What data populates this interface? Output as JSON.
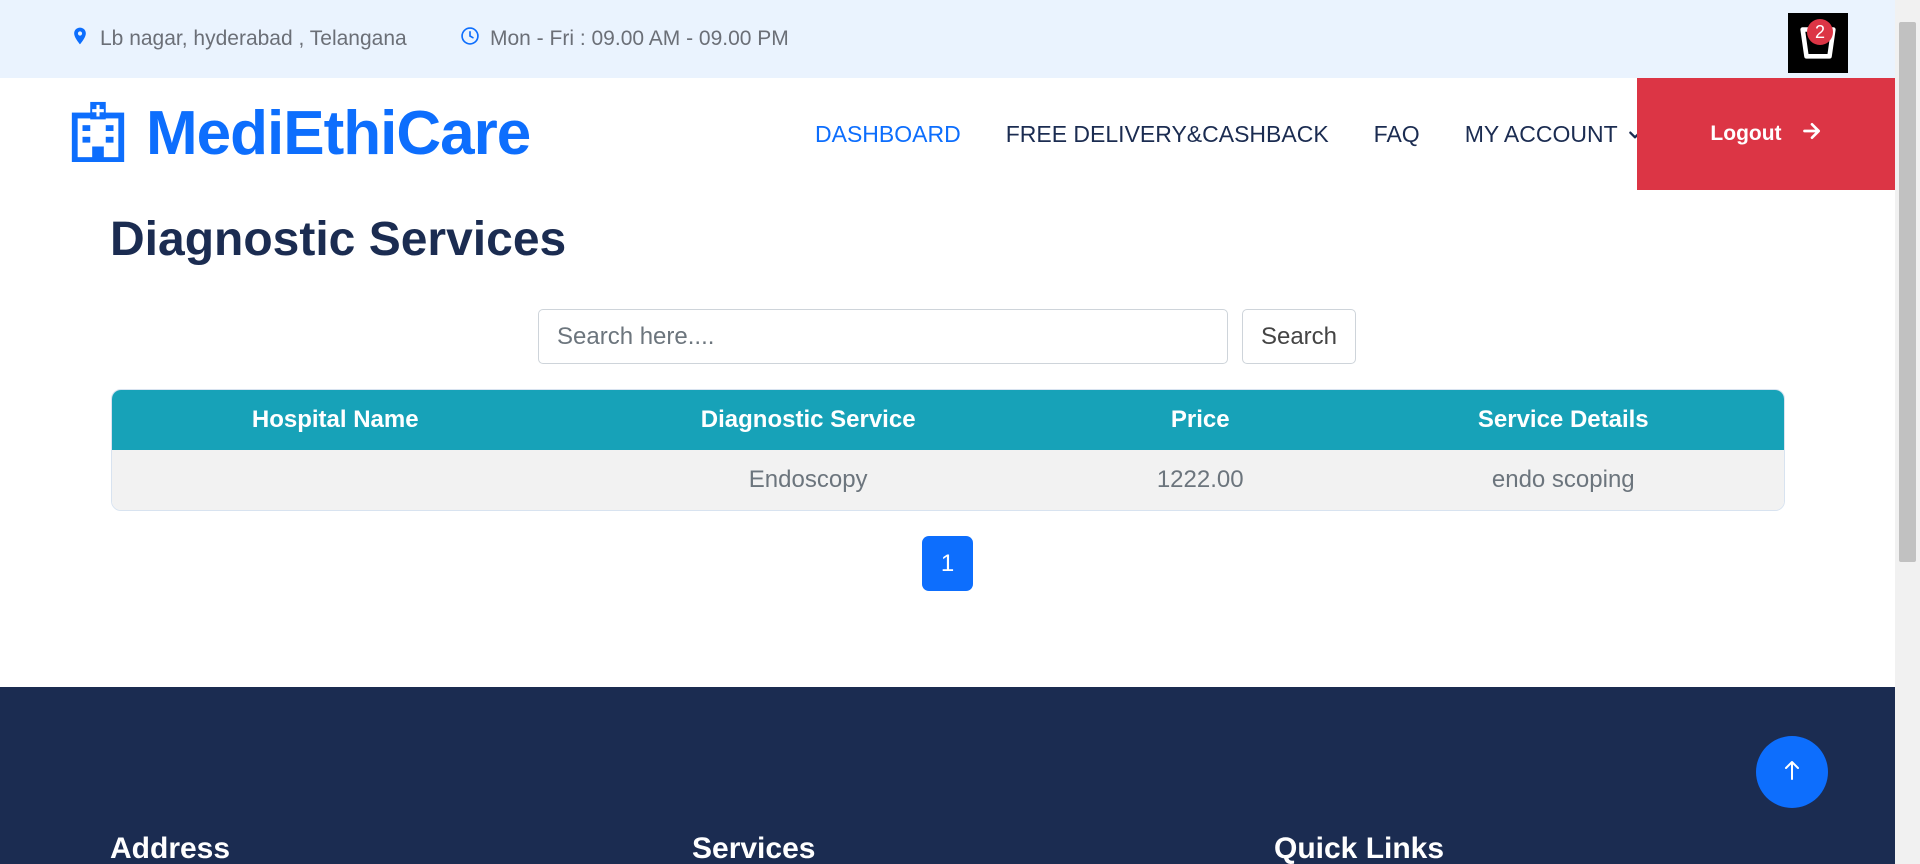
{
  "topbar": {
    "location": "Lb nagar, hyderabad , Telangana",
    "hours": "Mon - Fri : 09.00 AM - 09.00 PM",
    "cart_count": "2"
  },
  "brand": {
    "name": "MediEthiCare",
    "icon": "hospital-icon"
  },
  "nav": {
    "items": [
      "DASHBOARD",
      "FREE DELIVERY&CASHBACK",
      "FAQ",
      "MY ACCOUNT"
    ],
    "logout_label": "Logout"
  },
  "page": {
    "title": "Diagnostic Services",
    "search_placeholder": "Search here....",
    "search_button": "Search"
  },
  "table": {
    "headers": [
      "Hospital Name",
      "Diagnostic Service",
      "Price",
      "Service Details"
    ],
    "rows": [
      [
        "",
        "Endoscopy",
        "1222.00",
        "endo scoping"
      ]
    ]
  },
  "pagination": {
    "current": "1"
  },
  "footer": {
    "sections": [
      "Address",
      "Services",
      "Quick Links"
    ]
  },
  "colors": {
    "primary": "#0d6efd",
    "table_header": "#17a2b8",
    "logout": "#dc3545",
    "footer_bg": "#1b2c51"
  }
}
